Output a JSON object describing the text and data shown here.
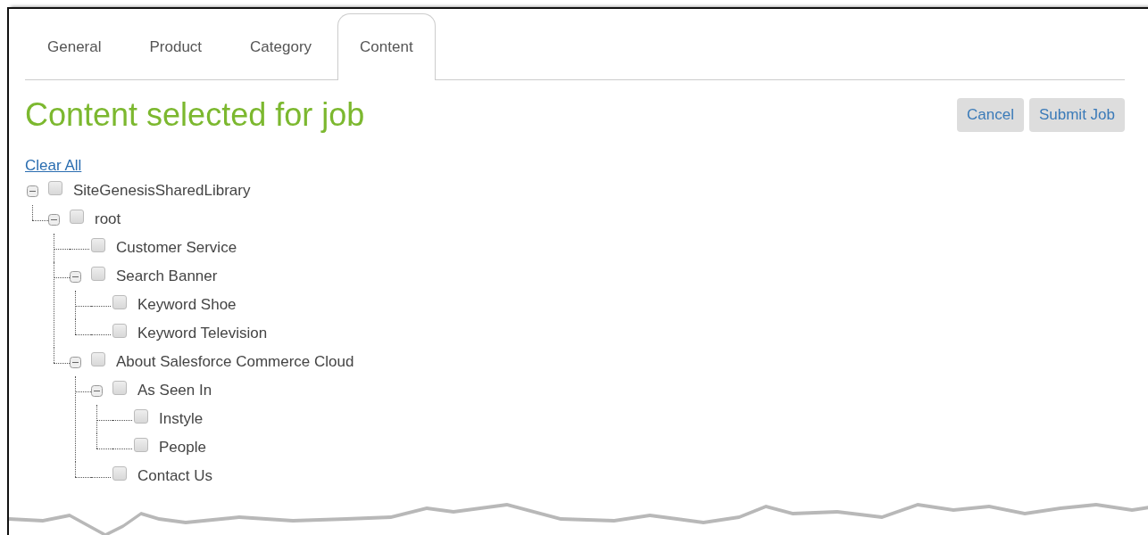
{
  "tabs": [
    {
      "label": "General",
      "selected": false
    },
    {
      "label": "Product",
      "selected": false
    },
    {
      "label": "Category",
      "selected": false
    },
    {
      "label": "Content",
      "selected": true
    }
  ],
  "heading": "Content selected for job",
  "buttons": [
    {
      "label": "Cancel"
    },
    {
      "label": "Submit Job"
    }
  ],
  "clear_all_link": "Clear All",
  "tree": [
    {
      "label": "SiteGenesisSharedLibrary",
      "checked": false,
      "expanded": true,
      "children": [
        {
          "label": "root",
          "checked": false,
          "expanded": true,
          "children": [
            {
              "label": "Customer Service",
              "checked": false
            },
            {
              "label": "Search Banner",
              "checked": false,
              "expanded": true,
              "children": [
                {
                  "label": "Keyword Shoe",
                  "checked": false
                },
                {
                  "label": "Keyword Television",
                  "checked": false
                }
              ]
            },
            {
              "label": "About Salesforce Commerce Cloud",
              "checked": false,
              "expanded": true,
              "children": [
                {
                  "label": "As Seen In",
                  "checked": false,
                  "expanded": true,
                  "children": [
                    {
                      "label": "Instyle",
                      "checked": false
                    },
                    {
                      "label": "People",
                      "checked": false
                    }
                  ]
                },
                {
                  "label": "Contact Us",
                  "checked": false
                }
              ]
            }
          ]
        }
      ]
    }
  ]
}
